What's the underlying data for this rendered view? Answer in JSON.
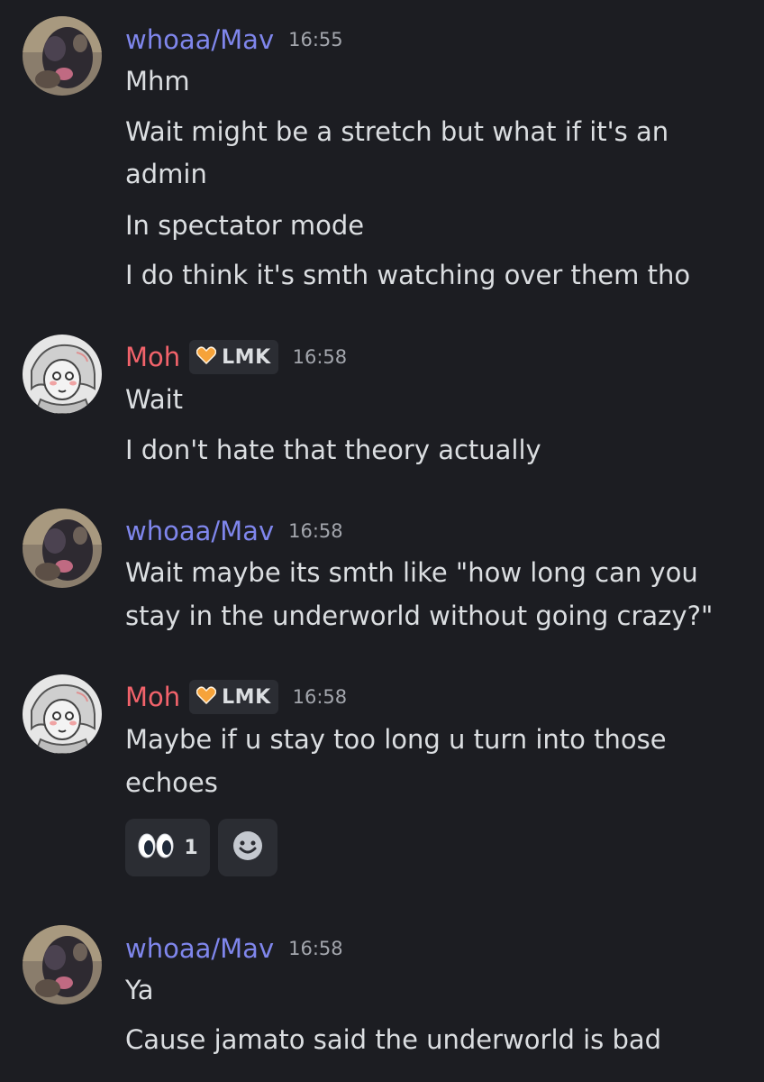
{
  "messages": [
    {
      "author": "whoaa/Mav",
      "time": "16:55",
      "lines": [
        "Mhm",
        "Wait might be a stretch but what if it's an",
        "admin",
        "In spectator mode",
        "I do think it's smth watching over them tho"
      ]
    },
    {
      "author": "Moh",
      "tag": "LMK",
      "time": "16:58",
      "lines": [
        "Wait",
        "I don't hate that theory actually"
      ]
    },
    {
      "author": "whoaa/Mav",
      "time": "16:58",
      "lines": [
        "Wait maybe its smth like \"how long can you",
        "stay in the underworld without going crazy?\""
      ]
    },
    {
      "author": "Moh",
      "tag": "LMK",
      "time": "16:58",
      "lines": [
        "Maybe if u stay too long u turn into those",
        "echoes"
      ],
      "reactions": [
        {
          "icon": "eyes-emoji-icon",
          "count": "1"
        }
      ]
    },
    {
      "author": "whoaa/Mav",
      "time": "16:58",
      "lines": [
        "Ya",
        "Cause jamato said the underworld is bad"
      ]
    }
  ],
  "colors": {
    "background": "#1c1d22",
    "mav_name": "#7f86ec",
    "moh_name": "#f2636b",
    "text": "#dbdee1",
    "timestamp": "#a3a6ad",
    "chip": "#2b2d33"
  },
  "icons": {
    "tag_icon": "orange-heart-icon",
    "add_reaction": "smiley-add-reaction-icon"
  }
}
